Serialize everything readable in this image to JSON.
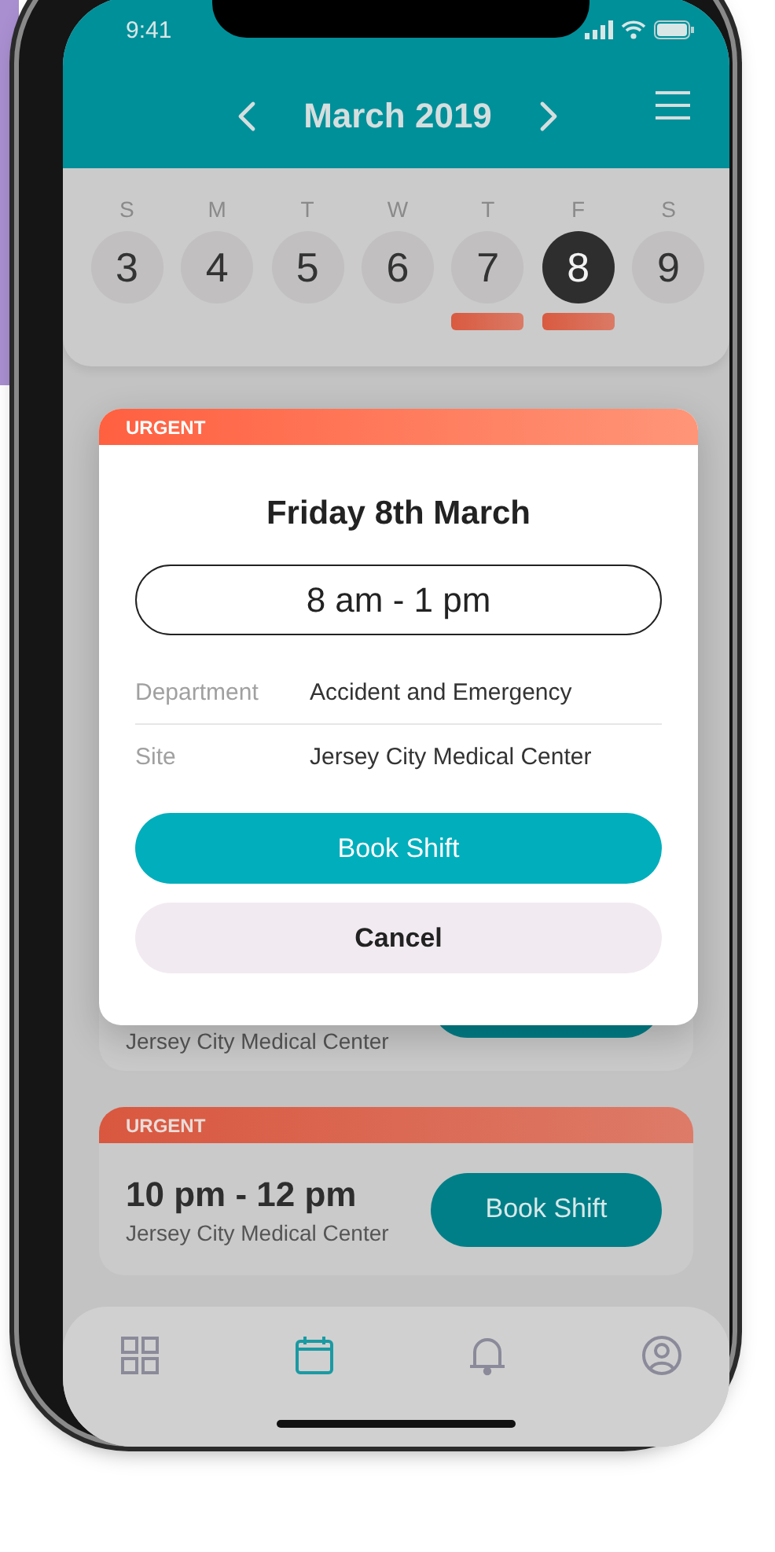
{
  "status_bar": {
    "time": "9:41"
  },
  "header": {
    "title": "March 2019"
  },
  "week": [
    {
      "weekday": "S",
      "date": "3",
      "selected": false,
      "has_shift": false
    },
    {
      "weekday": "M",
      "date": "4",
      "selected": false,
      "has_shift": false
    },
    {
      "weekday": "T",
      "date": "5",
      "selected": false,
      "has_shift": false
    },
    {
      "weekday": "W",
      "date": "6",
      "selected": false,
      "has_shift": false
    },
    {
      "weekday": "T",
      "date": "7",
      "selected": false,
      "has_shift": true
    },
    {
      "weekday": "F",
      "date": "8",
      "selected": true,
      "has_shift": true
    },
    {
      "weekday": "S",
      "date": "9",
      "selected": false,
      "has_shift": false
    }
  ],
  "hidden_card": {
    "site": "Jersey City Medical Center"
  },
  "shift_cards": [
    {
      "badge": "URGENT",
      "time": "10 pm - 12 pm",
      "site": "Jersey City Medical Center",
      "button": "Book Shift"
    }
  ],
  "dialog": {
    "badge": "URGENT",
    "title": "Friday 8th March",
    "time": "8 am - 1 pm",
    "details": [
      {
        "label": "Department",
        "value": "Accident and Emergency"
      },
      {
        "label": "Site",
        "value": "Jersey City Medical Center"
      }
    ],
    "buttons": [
      {
        "label": "Book Shift",
        "kind": "primary"
      },
      {
        "label": "Cancel",
        "kind": "secondary"
      }
    ]
  },
  "tab_bar": [
    {
      "kind": "grid",
      "selected": false
    },
    {
      "kind": "calendar",
      "selected": true
    },
    {
      "kind": "bell",
      "selected": false
    },
    {
      "kind": "profile",
      "selected": false
    }
  ]
}
